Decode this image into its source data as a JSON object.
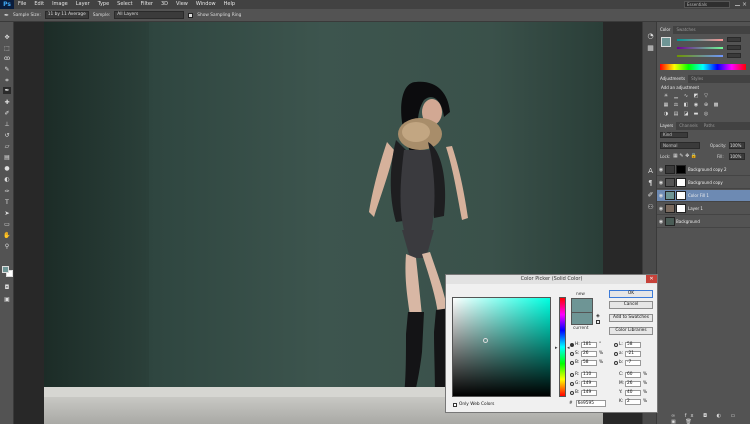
{
  "menu": {
    "logo": "Ps",
    "items": [
      "File",
      "Edit",
      "Image",
      "Layer",
      "Type",
      "Select",
      "Filter",
      "3D",
      "View",
      "Window",
      "Help"
    ],
    "workspace": "Essentials"
  },
  "options": {
    "sample_size_label": "Sample Size:",
    "sample_size_value": "11 by 11 Average",
    "sample_label": "Sample:",
    "sample_value": "All Layers",
    "show_ring_label": "Show Sampling Ring"
  },
  "panels": {
    "color_tabs": [
      "Color",
      "Swatches"
    ],
    "adjust_tabs": [
      "Adjustments",
      "Styles"
    ],
    "adjust_title": "Add an adjustment",
    "layers_tabs": [
      "Layers",
      "Channels",
      "Paths"
    ],
    "kind_label": "Kind",
    "blend_mode": "Normal",
    "opacity_label": "Opacity:",
    "opacity_value": "100%",
    "lock_label": "Lock:",
    "fill_label": "Fill:",
    "fill_value": "100%"
  },
  "layers": [
    {
      "name": "Background copy 2"
    },
    {
      "name": "Background copy"
    },
    {
      "name": "Color Fill 1"
    },
    {
      "name": "Layer 1"
    },
    {
      "name": "Background"
    }
  ],
  "dialog": {
    "title": "Color Picker (Solid Color)",
    "new_label": "new",
    "current_label": "current",
    "buttons": {
      "ok": "OK",
      "cancel": "Cancel",
      "add_swatches": "Add to Swatches",
      "libraries": "Color Libraries"
    },
    "fields_left": [
      {
        "label": "H:",
        "value": "181",
        "unit": "°"
      },
      {
        "label": "S:",
        "value": "26",
        "unit": "%"
      },
      {
        "label": "B:",
        "value": "58",
        "unit": "%"
      },
      {
        "label": "R:",
        "value": "110",
        "unit": ""
      },
      {
        "label": "G:",
        "value": "149",
        "unit": ""
      },
      {
        "label": "B:",
        "value": "149",
        "unit": ""
      }
    ],
    "fields_right": [
      {
        "label": "L:",
        "value": "58",
        "unit": ""
      },
      {
        "label": "a:",
        "value": "-21",
        "unit": ""
      },
      {
        "label": "b:",
        "value": "-7",
        "unit": ""
      },
      {
        "label": "C:",
        "value": "60",
        "unit": "%"
      },
      {
        "label": "M:",
        "value": "26",
        "unit": "%"
      },
      {
        "label": "Y:",
        "value": "40",
        "unit": "%"
      },
      {
        "label": "K:",
        "value": "2",
        "unit": "%"
      }
    ],
    "hex_label": "#",
    "hex_value": "6e9595",
    "only_web": "Only Web Colors"
  },
  "colors": {
    "new_color": "#6e9595",
    "foreground": "#6e9595",
    "background": "#ffffff"
  }
}
